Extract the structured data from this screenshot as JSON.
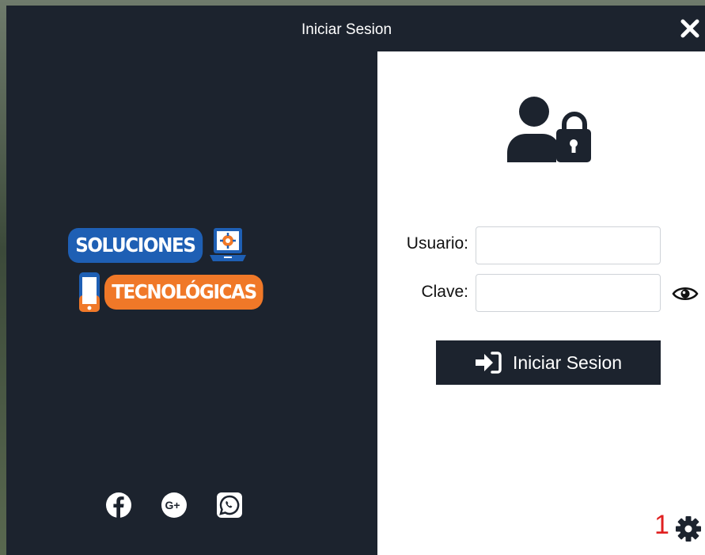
{
  "window": {
    "title": "Iniciar Sesion"
  },
  "brand": {
    "logo_line1": "SOLUCIONES",
    "logo_line2": "TECNOLÓGICAS",
    "colors": {
      "blue": "#1e5fb4",
      "orange": "#f07828",
      "dark": "#1c232e"
    },
    "social": [
      "facebook-icon",
      "google-plus-icon",
      "whatsapp-icon"
    ]
  },
  "form": {
    "user_label": "Usuario:",
    "user_value": "",
    "password_label": "Clave:",
    "password_value": "",
    "submit_label": "Iniciar Sesion"
  },
  "footer": {
    "counter": "1"
  }
}
